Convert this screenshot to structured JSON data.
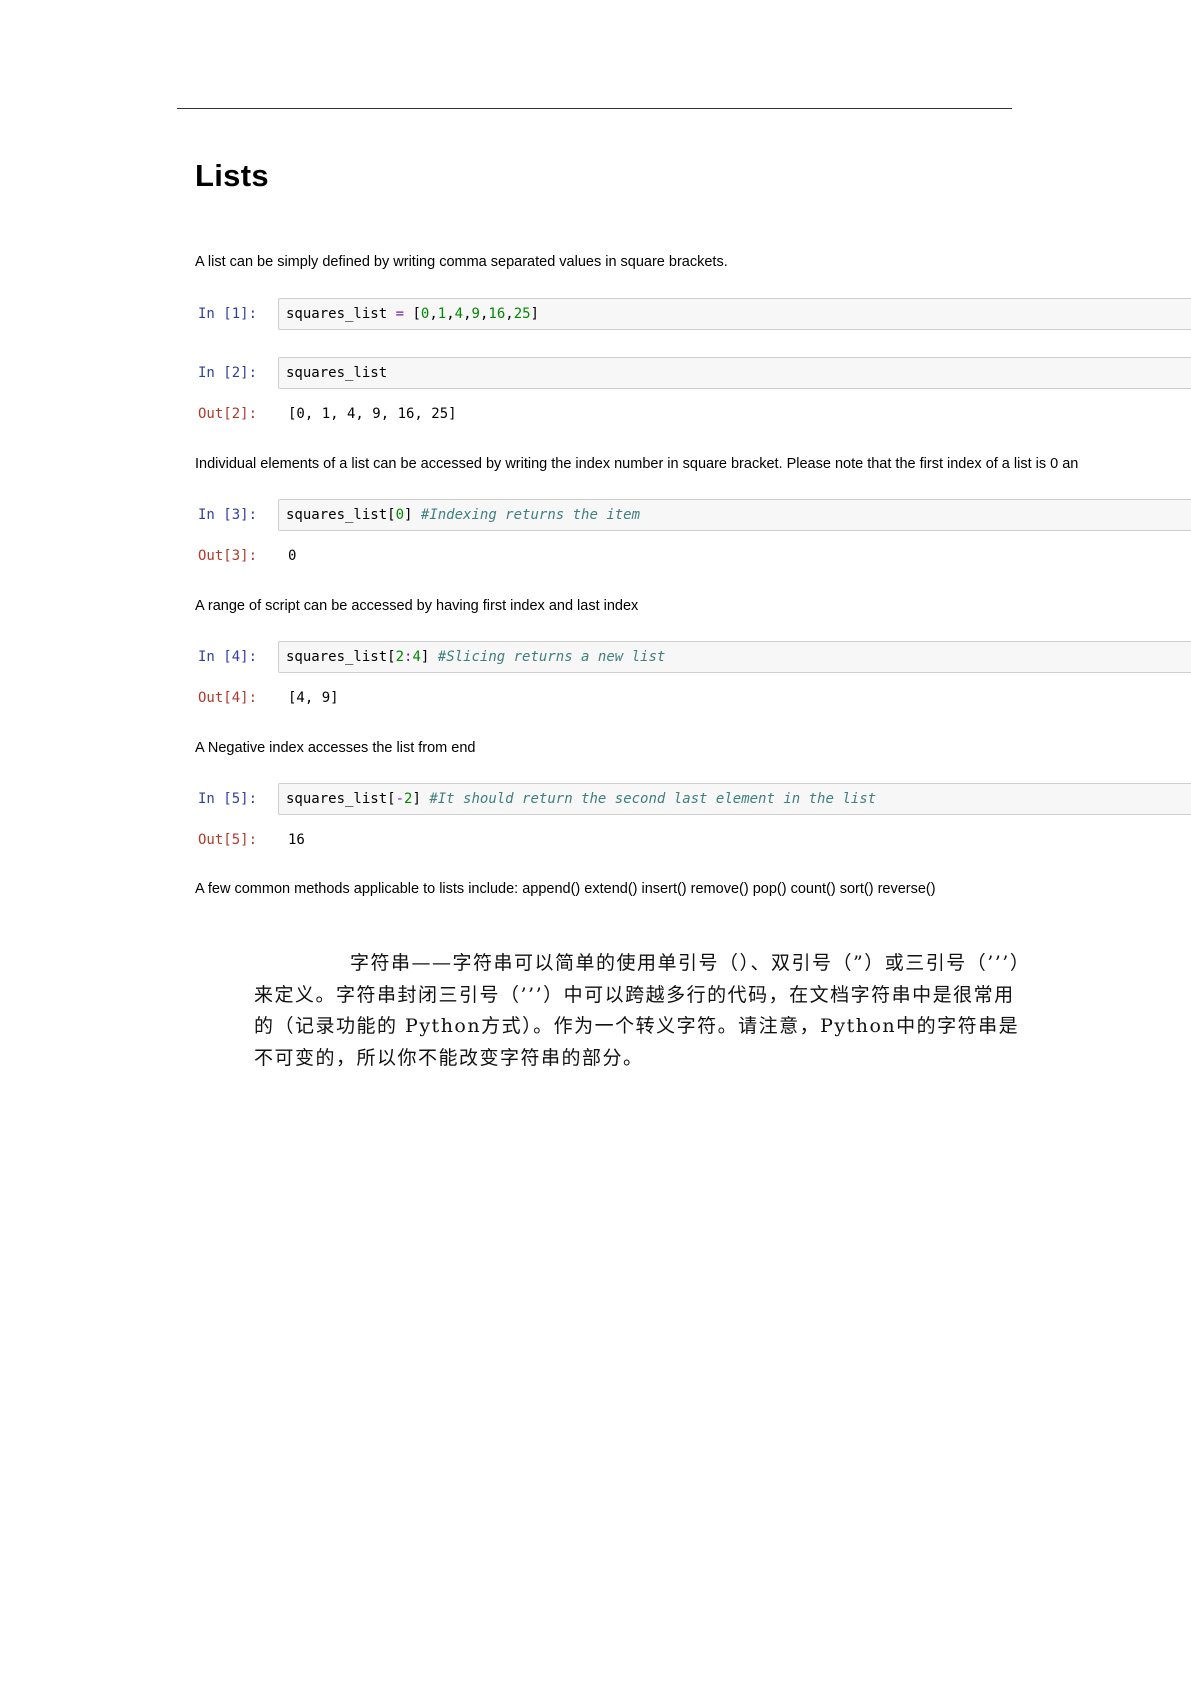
{
  "notebook": {
    "title": "Lists",
    "md1": "A list can be simply defined by writing comma separated values in square brackets.",
    "cells": [
      {
        "in_prompt": "In [1]:",
        "code": {
          "var": "squares_list",
          "eq": " = ",
          "open": "[",
          "nums": [
            "0",
            "1",
            "4",
            "9",
            "16",
            "25"
          ],
          "close": "]"
        }
      },
      {
        "in_prompt": "In [2]:",
        "code_text": "squares_list",
        "out_prompt": "Out[2]:",
        "output": "[0, 1, 4, 9, 16, 25]"
      },
      {
        "in_prompt": "In [3]:",
        "code_var": "squares_list",
        "code_index": "0",
        "comment": "#Indexing returns the item",
        "out_prompt": "Out[3]:",
        "output": "0"
      },
      {
        "in_prompt": "In [4]:",
        "code_var": "squares_list",
        "code_index_a": "2",
        "code_index_b": "4",
        "comment": "#Slicing returns a new list",
        "out_prompt": "Out[4]:",
        "output": "[4, 9]"
      },
      {
        "in_prompt": "In [5]:",
        "code_var": "squares_list",
        "code_index_op": "-",
        "code_index": "2",
        "comment": "#It should return the second last element in the list",
        "out_prompt": "Out[5]:",
        "output": "16"
      }
    ],
    "md2": "Individual elements of a list can be accessed by writing the index number in square bracket. Please note that the first index of a list is 0 an",
    "md3": "A range of script can be accessed by having first index and last index",
    "md4": "A Negative index accesses the list from end",
    "md5": "A few common methods applicable to lists include: append() extend() insert() remove() pop() count() sort() reverse()"
  },
  "chinese_paragraph": "字符串——字符串可以简单的使用单引号（）、双引号（”）或三引号（’’’）来定义。字符串封闭三引号（’’’）中可以跨越多行的代码，在文档字符串中是很常用的（记录功能的 Python方式）。作为一个转义字符。请注意，Python中的字符串是不可变的，所以你不能改变字符串的部分。"
}
